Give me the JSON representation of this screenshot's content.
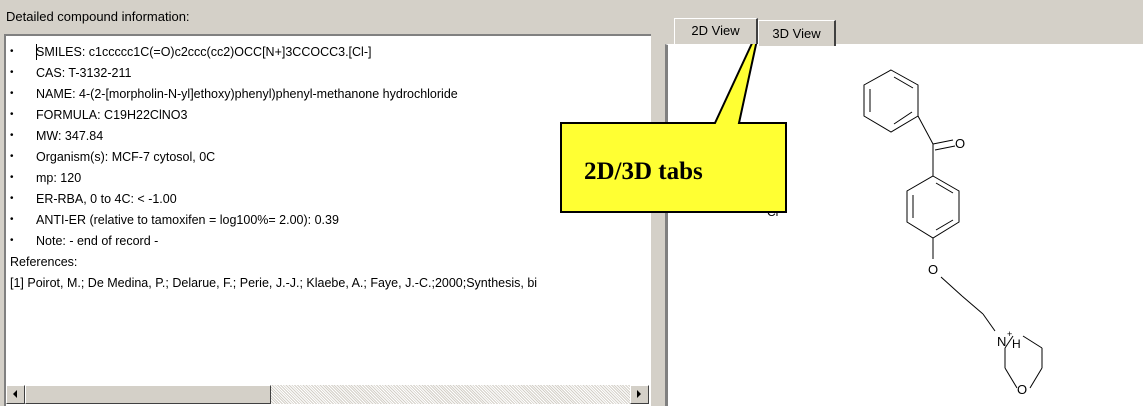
{
  "panel_title": "Detailed compound information:",
  "bullets": [
    "SMILES: c1ccccc1C(=O)c2ccc(cc2)OCC[N+]3CCOCC3.[Cl-]",
    "CAS: T-3132-211",
    "NAME: 4-(2-[morpholin-N-yl]ethoxy)phenyl)phenyl-methanone hydrochloride",
    "FORMULA: C19H22ClNO3",
    "MW: 347.84",
    "Organism(s): MCF-7 cytosol, 0C",
    "mp: 120",
    "ER-RBA, 0 to 4C: < -1.00",
    "ANTI-ER (relative to tamoxifen = log100%= 2.00): 0.39",
    "Note: - end of record -"
  ],
  "references_label": "References:",
  "reference_1": "[1]  Poirot, M.; De Medina, P.; Delarue, F.; Perie, J.-J.; Klaebe, A.; Faye, J.-C.;2000;Synthesis, bi",
  "bullet_symbol": "•",
  "tabs": {
    "tab_2d": "2D View",
    "tab_3d": "3D View"
  },
  "callout": {
    "text": "2D/3D tabs",
    "fill": "#ffff33"
  },
  "molecule": {
    "oxygen_carbonyl": "O",
    "oxygen_ether": "O",
    "oxygen_ring": "O",
    "nitrogen": "N",
    "nh_plus": "+",
    "hydrogen": "H",
    "chloride": "Cl",
    "chloride_charge": "-"
  }
}
